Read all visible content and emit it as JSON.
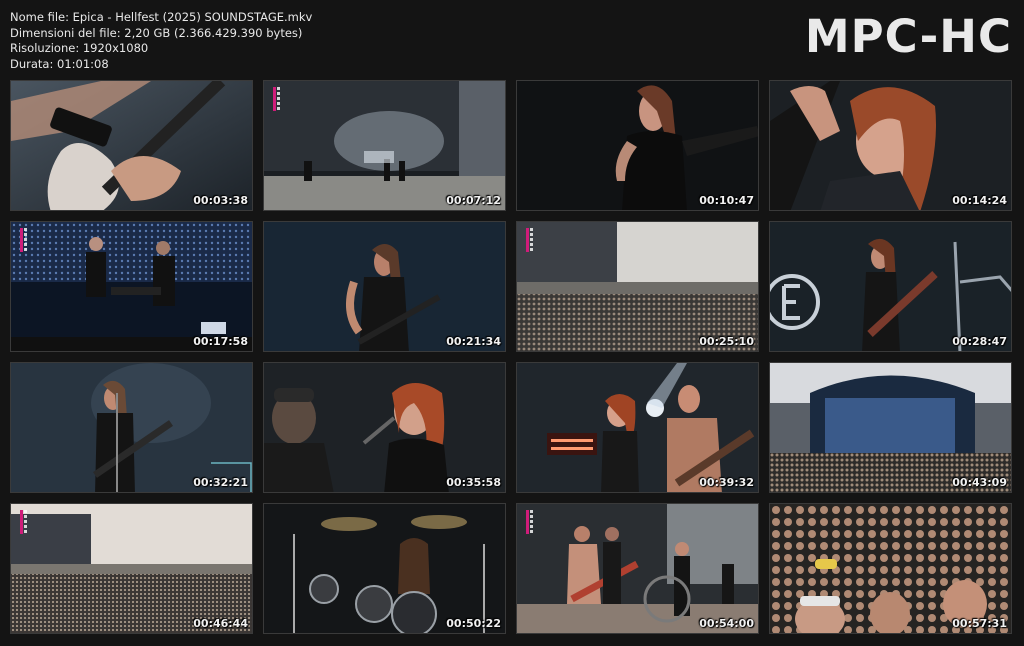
{
  "file_info": {
    "name_line": "Nome file: Epica - Hellfest (2025) SOUNDSTAGE.mkv",
    "size_line": "Dimensioni del file: 2,20 GB (2.366.429.390 bytes)",
    "resolution_line": "Risoluzione: 1920x1080",
    "duration_line": "Durata: 01:01:08"
  },
  "logo": "MPC-HC",
  "thumbnails": [
    {
      "time": "00:03:38"
    },
    {
      "time": "00:07:12"
    },
    {
      "time": "00:10:47"
    },
    {
      "time": "00:14:24"
    },
    {
      "time": "00:17:58"
    },
    {
      "time": "00:21:34"
    },
    {
      "time": "00:25:10"
    },
    {
      "time": "00:28:47"
    },
    {
      "time": "00:32:21"
    },
    {
      "time": "00:35:58"
    },
    {
      "time": "00:39:32"
    },
    {
      "time": "00:43:09"
    },
    {
      "time": "00:46:44"
    },
    {
      "time": "00:50:22"
    },
    {
      "time": "00:54:00"
    },
    {
      "time": "00:57:31"
    }
  ],
  "colors": {
    "background": "#141414",
    "text": "#e8e8e8",
    "channel_accent": "#d01c7a"
  }
}
